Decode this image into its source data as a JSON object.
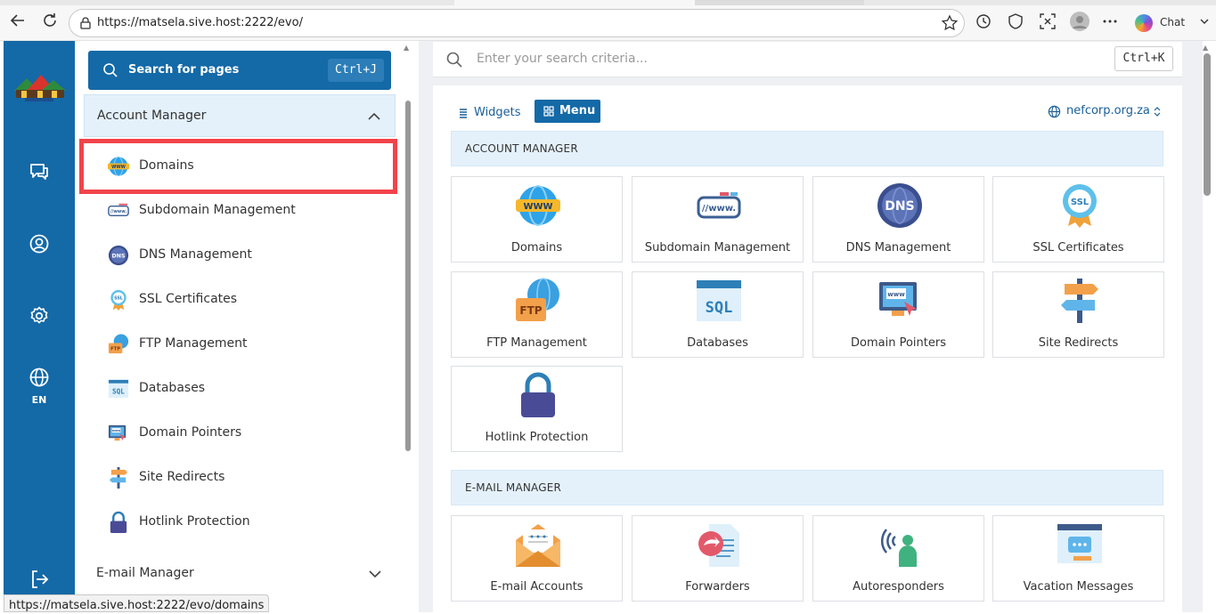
{
  "browser": {
    "url": "https://matsela.sive.host:2222/evo/",
    "chat_label": "Chat",
    "status_url": "https://matsela.sive.host:2222/evo/domains"
  },
  "rail": {
    "language": "EN"
  },
  "sidebar": {
    "search_label": "Search for pages",
    "search_shortcut": "Ctrl+J",
    "section_title": "Account Manager",
    "items": [
      {
        "label": "Domains",
        "icon": "www-globe-icon"
      },
      {
        "label": "Subdomain Management",
        "icon": "subdomain-icon"
      },
      {
        "label": "DNS Management",
        "icon": "dns-icon"
      },
      {
        "label": "SSL Certificates",
        "icon": "ssl-badge-icon"
      },
      {
        "label": "FTP Management",
        "icon": "ftp-icon"
      },
      {
        "label": "Databases",
        "icon": "sql-icon"
      },
      {
        "label": "Domain Pointers",
        "icon": "domain-pointer-icon"
      },
      {
        "label": "Site Redirects",
        "icon": "signpost-icon"
      },
      {
        "label": "Hotlink Protection",
        "icon": "lock-icon"
      }
    ],
    "next_section_title": "E-mail Manager"
  },
  "main": {
    "search_placeholder": "Enter your search criteria...",
    "search_shortcut": "Ctrl+K",
    "tab_widgets": "Widgets",
    "tab_menu": "Menu",
    "domain": "nefcorp.org.za",
    "sections": [
      {
        "title": "ACCOUNT MANAGER",
        "tiles": [
          {
            "label": "Domains",
            "icon": "www-globe-icon"
          },
          {
            "label": "Subdomain Management",
            "icon": "subdomain-icon"
          },
          {
            "label": "DNS Management",
            "icon": "dns-icon"
          },
          {
            "label": "SSL Certificates",
            "icon": "ssl-badge-icon"
          },
          {
            "label": "FTP Management",
            "icon": "ftp-icon"
          },
          {
            "label": "Databases",
            "icon": "sql-icon"
          },
          {
            "label": "Domain Pointers",
            "icon": "domain-pointer-icon"
          },
          {
            "label": "Site Redirects",
            "icon": "signpost-icon"
          },
          {
            "label": "Hotlink Protection",
            "icon": "lock-icon"
          }
        ]
      },
      {
        "title": "E-MAIL MANAGER",
        "tiles": [
          {
            "label": "E-mail Accounts",
            "icon": "envelope-icon"
          },
          {
            "label": "Forwarders",
            "icon": "forward-icon"
          },
          {
            "label": "Autoresponders",
            "icon": "autoresponder-icon"
          },
          {
            "label": "Vacation Messages",
            "icon": "vacation-message-icon"
          }
        ]
      }
    ]
  },
  "colors": {
    "brand_blue": "#1469a7",
    "section_bg": "#e4f1fb",
    "highlight_red": "#f2434a"
  }
}
